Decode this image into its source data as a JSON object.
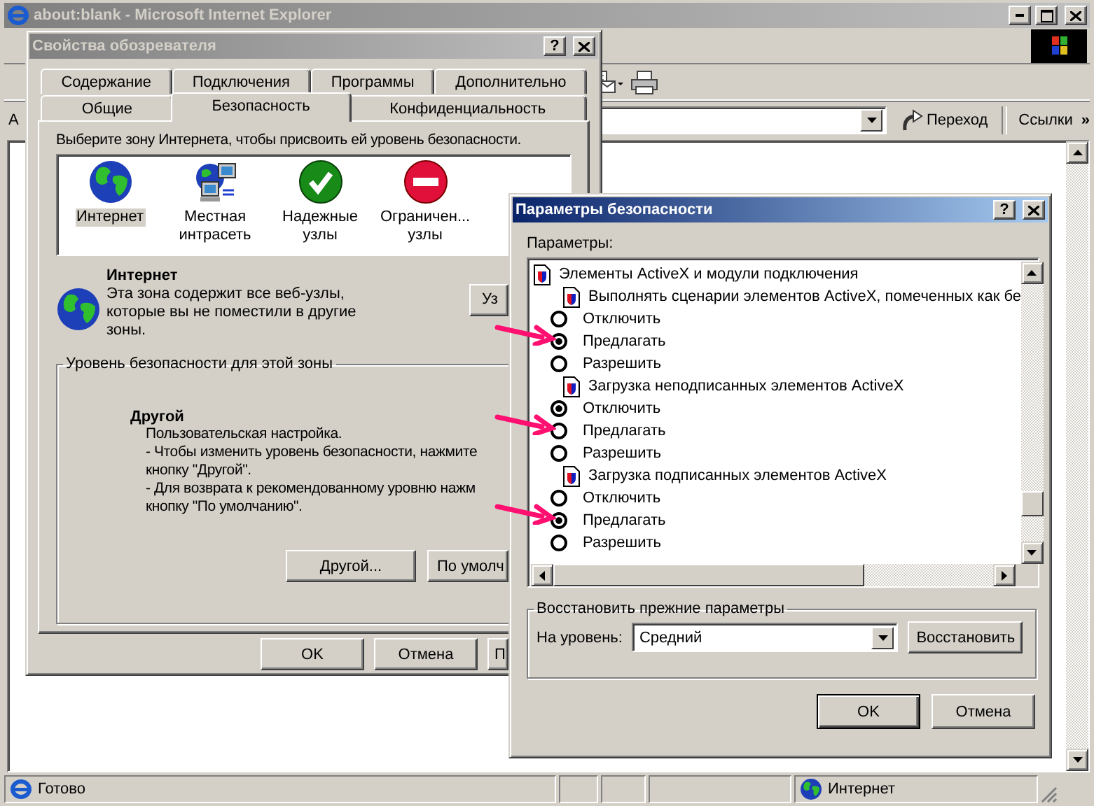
{
  "browser": {
    "title": "about:blank - Microsoft Internet Explorer",
    "address_label": "А",
    "go_button": "Переход",
    "links_label": "Ссылки",
    "links_more": "»",
    "status_text": "Готово",
    "status_zone": "Интернет"
  },
  "options_dialog": {
    "title": "Свойства обозревателя",
    "help": "?",
    "tab_rows": [
      {
        "tabs": [
          {
            "label": "Содержание",
            "selected": false
          },
          {
            "label": "Подключения",
            "selected": false
          },
          {
            "label": "Программы",
            "selected": false
          },
          {
            "label": "Дополнительно",
            "selected": false
          }
        ]
      },
      {
        "tabs": [
          {
            "label": "Общие",
            "selected": false
          },
          {
            "label": "Безопасность",
            "selected": true
          },
          {
            "label": "Конфиденциальность",
            "selected": false
          }
        ]
      }
    ],
    "prompt": "Выберите зону Интернета, чтобы присвоить ей уровень безопасности.",
    "zones": [
      {
        "kind": "internet",
        "label": "Интернет",
        "selected": true
      },
      {
        "kind": "intranet",
        "label": "Местная интрасеть",
        "selected": false
      },
      {
        "kind": "trusted",
        "label": "Надежные узлы",
        "selected": false
      },
      {
        "kind": "restricted",
        "label": "Ограничен... узлы",
        "selected": false
      }
    ],
    "zone_name": "Интернет",
    "zone_description": [
      "Эта зона содержит все веб-узлы,",
      "которые вы не поместили в другие",
      "зоны."
    ],
    "zone_button": "Уз",
    "level_legend": "Уровень безопасности для этой зоны",
    "level_name": "Другой",
    "level_lines": [
      "Пользовательская настройка.",
      "- Чтобы изменить уровень безопасности, нажмите",
      "кнопку \"Другой\".",
      "- Для возврата к рекомендованному уровню нажм",
      "кнопку \"По умолчанию\"."
    ],
    "level_buttons": [
      "Другой...",
      "По умолч"
    ],
    "buttons": [
      "OK",
      "Отмена",
      "П"
    ]
  },
  "security_dialog": {
    "title": "Параметры безопасности",
    "help": "?",
    "list_label": "Параметры:",
    "tree": [
      {
        "kind": "category",
        "label": "Элементы ActiveX и модули подключения",
        "children": [
          {
            "kind": "setting",
            "label": "Выполнять сценарии элементов ActiveX, помеченных как бе",
            "children": [
              {
                "kind": "option",
                "label": "Отключить",
                "selected": false,
                "pointed": false
              },
              {
                "kind": "option",
                "label": "Предлагать",
                "selected": true,
                "pointed": true
              },
              {
                "kind": "option",
                "label": "Разрешить",
                "selected": false,
                "pointed": false
              }
            ]
          },
          {
            "kind": "setting",
            "label": "Загрузка неподписанных элементов ActiveX",
            "children": [
              {
                "kind": "option",
                "label": "Отключить",
                "selected": true,
                "pointed": false
              },
              {
                "kind": "option",
                "label": "Предлагать",
                "selected": false,
                "pointed": true
              },
              {
                "kind": "option",
                "label": "Разрешить",
                "selected": false,
                "pointed": false
              }
            ]
          },
          {
            "kind": "setting",
            "label": "Загрузка подписанных элементов ActiveX",
            "children": [
              {
                "kind": "option",
                "label": "Отключить",
                "selected": false,
                "pointed": false
              },
              {
                "kind": "option",
                "label": "Предлагать",
                "selected": true,
                "pointed": true
              },
              {
                "kind": "option",
                "label": "Разрешить",
                "selected": false,
                "pointed": false
              }
            ]
          }
        ]
      }
    ],
    "reset_legend": "Восстановить прежние параметры",
    "level_label": "На уровень:",
    "level_value": "Средний",
    "reset_button": "Восстановить",
    "buttons": [
      {
        "label": "OK",
        "default": true
      },
      {
        "label": "Отмена",
        "default": false
      }
    ]
  }
}
